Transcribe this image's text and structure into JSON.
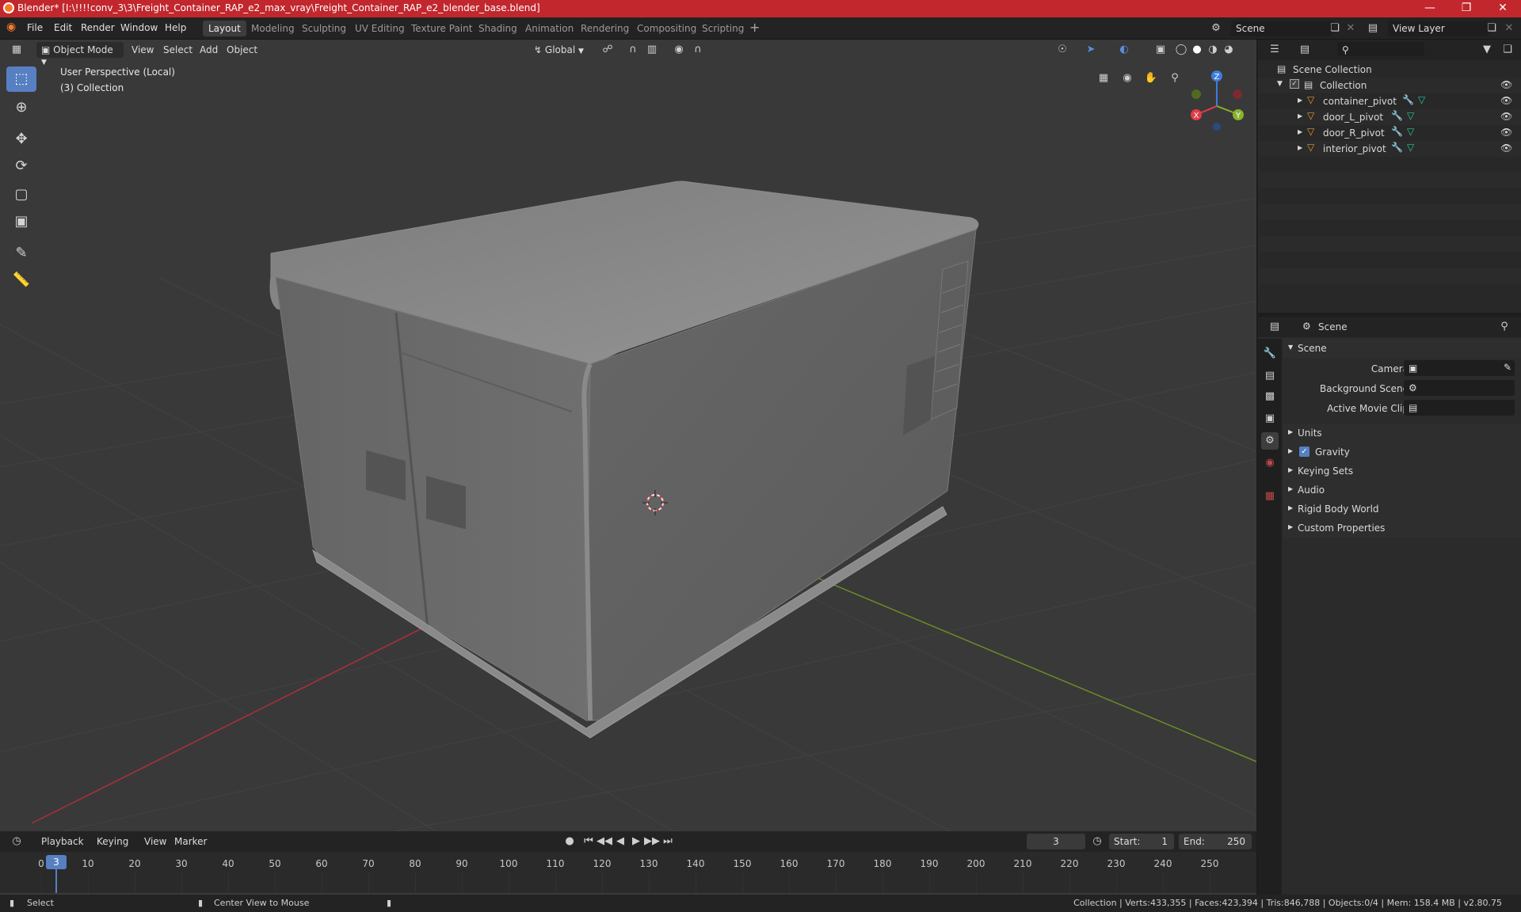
{
  "window": {
    "title": "Blender* [I:\\!!!!conv_3\\3\\Freight_Container_RAP_e2_max_vray\\Freight_Container_RAP_e2_blender_base.blend]"
  },
  "menus": [
    "File",
    "Edit",
    "Render",
    "Window",
    "Help"
  ],
  "workspaces": [
    "Layout",
    "Modeling",
    "Sculpting",
    "UV Editing",
    "Texture Paint",
    "Shading",
    "Animation",
    "Rendering",
    "Compositing",
    "Scripting"
  ],
  "active_workspace": "Layout",
  "scene_field": "Scene",
  "view_layer_field": "View Layer",
  "viewport": {
    "mode": "Object Mode",
    "header_menus": [
      "View",
      "Select",
      "Add",
      "Object"
    ],
    "orientation": "Global",
    "perspective_label": "User Perspective (Local)",
    "collection_label": "(3) Collection",
    "gizmo": {
      "x": "X",
      "y": "Y",
      "z": "Z"
    }
  },
  "outliner": {
    "root": "Scene Collection",
    "collection": "Collection",
    "objects": [
      "container_pivot",
      "door_L_pivot",
      "door_R_pivot",
      "interior_pivot"
    ]
  },
  "properties": {
    "breadcrumb": "Scene",
    "panel_title": "Scene",
    "fields": [
      {
        "label": "Camera",
        "value": ""
      },
      {
        "label": "Background Scene",
        "value": ""
      },
      {
        "label": "Active Movie Clip",
        "value": ""
      }
    ],
    "sections": [
      "Units",
      "Gravity",
      "Keying Sets",
      "Audio",
      "Rigid Body World",
      "Custom Properties"
    ],
    "gravity_checked": true
  },
  "timeline": {
    "menus": [
      "Playback",
      "Keying",
      "View",
      "Marker"
    ],
    "current_frame": "3",
    "start_label": "Start:",
    "start": "1",
    "end_label": "End:",
    "end": "250",
    "ticks": [
      "0",
      "10",
      "20",
      "30",
      "40",
      "50",
      "60",
      "70",
      "80",
      "90",
      "100",
      "110",
      "120",
      "130",
      "140",
      "150",
      "160",
      "170",
      "180",
      "190",
      "200",
      "210",
      "220",
      "230",
      "240",
      "250"
    ]
  },
  "statusbar": {
    "left_action": "Select",
    "middle_action": "Center View to Mouse",
    "stats": "Collection | Verts:433,355 | Faces:423,394 | Tris:846,788 | Objects:0/4 | Mem: 158.4 MB | v2.80.75"
  },
  "colors": {
    "title_bar": "#c1272d",
    "accent_blue": "#5680c2",
    "x_axis": "#e03c48",
    "y_axis": "#8ab22e",
    "z_axis": "#3e7ddb",
    "object_orange": "#e09a3b"
  }
}
